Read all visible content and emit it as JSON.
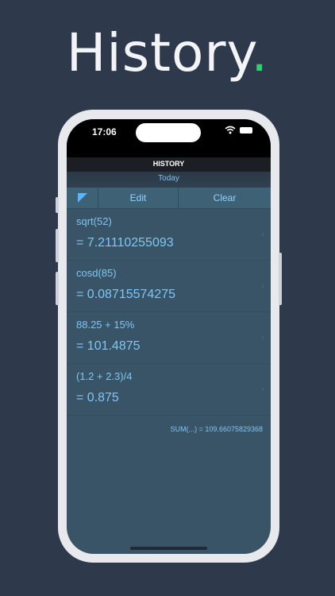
{
  "promo": {
    "headline": "History",
    "dot": "."
  },
  "status_bar": {
    "time": "17:06"
  },
  "navbar": {
    "title": "HISTORY",
    "subtitle": "Today"
  },
  "toolbar": {
    "edit_label": "Edit",
    "clear_label": "Clear"
  },
  "history": [
    {
      "expression": "sqrt(52)",
      "result": "= 7.21110255093"
    },
    {
      "expression": "cosd(85)",
      "result": "= 0.08715574275"
    },
    {
      "expression": "88.25 + 15%",
      "result": "= 101.4875"
    },
    {
      "expression": "(1.2 + 2.3)/4",
      "result": "= 0.875"
    }
  ],
  "sum_text": "SUM(...) = 109.66075829368",
  "colors": {
    "accent": "#7fc6f4",
    "background": "#2e3a4b",
    "dot": "#2fd16e"
  }
}
